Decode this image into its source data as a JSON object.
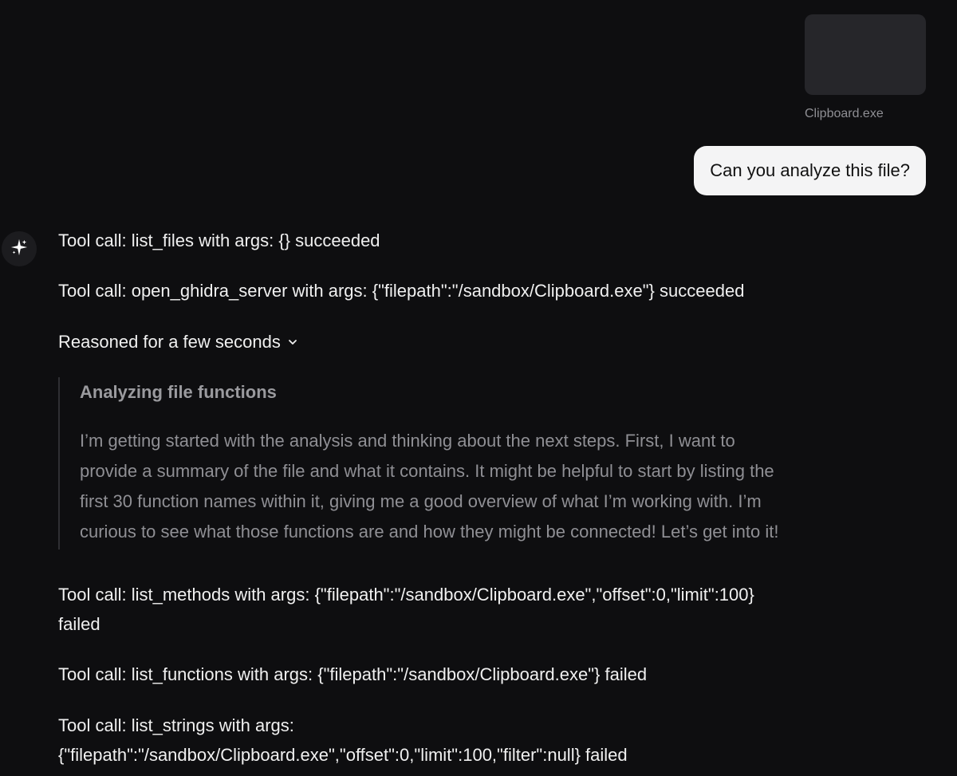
{
  "attachment": {
    "file_name": "Clipboard.exe"
  },
  "user_message": "Can you analyze this file?",
  "assistant": {
    "avatar_icon": "sparkle-icon",
    "tool_calls_before": [
      "Tool call: list_files with args: {} succeeded",
      "Tool call: open_ghidra_server with args: {\"filepath\":\"/sandbox/Clipboard.exe\"} succeeded"
    ],
    "reasoning": {
      "toggle_label": "Reasoned for a few seconds",
      "toggle_icon": "chevron-down-icon",
      "title": "Analyzing file functions",
      "lines": [
        "I’m getting started with the analysis and thinking about the next steps. First, I want to",
        "provide a summary of the file and what it contains. It might be helpful to start by listing the",
        "first 30 function names within it, giving me a good overview of what I’m working with. I’m",
        "curious to see what those functions are and how they might be connected! Let’s get into it!"
      ]
    },
    "tool_calls_after": [
      {
        "line1": "Tool call: list_methods with args: {\"filepath\":\"/sandbox/Clipboard.exe\",\"offset\":0,\"limit\":100}",
        "line2": "failed"
      },
      {
        "line1": "Tool call: list_functions with args: {\"filepath\":\"/sandbox/Clipboard.exe\"} failed"
      },
      {
        "line1": "Tool call: list_strings with args:",
        "line2": "{\"filepath\":\"/sandbox/Clipboard.exe\",\"offset\":0,\"limit\":100,\"filter\":null} failed"
      }
    ]
  }
}
